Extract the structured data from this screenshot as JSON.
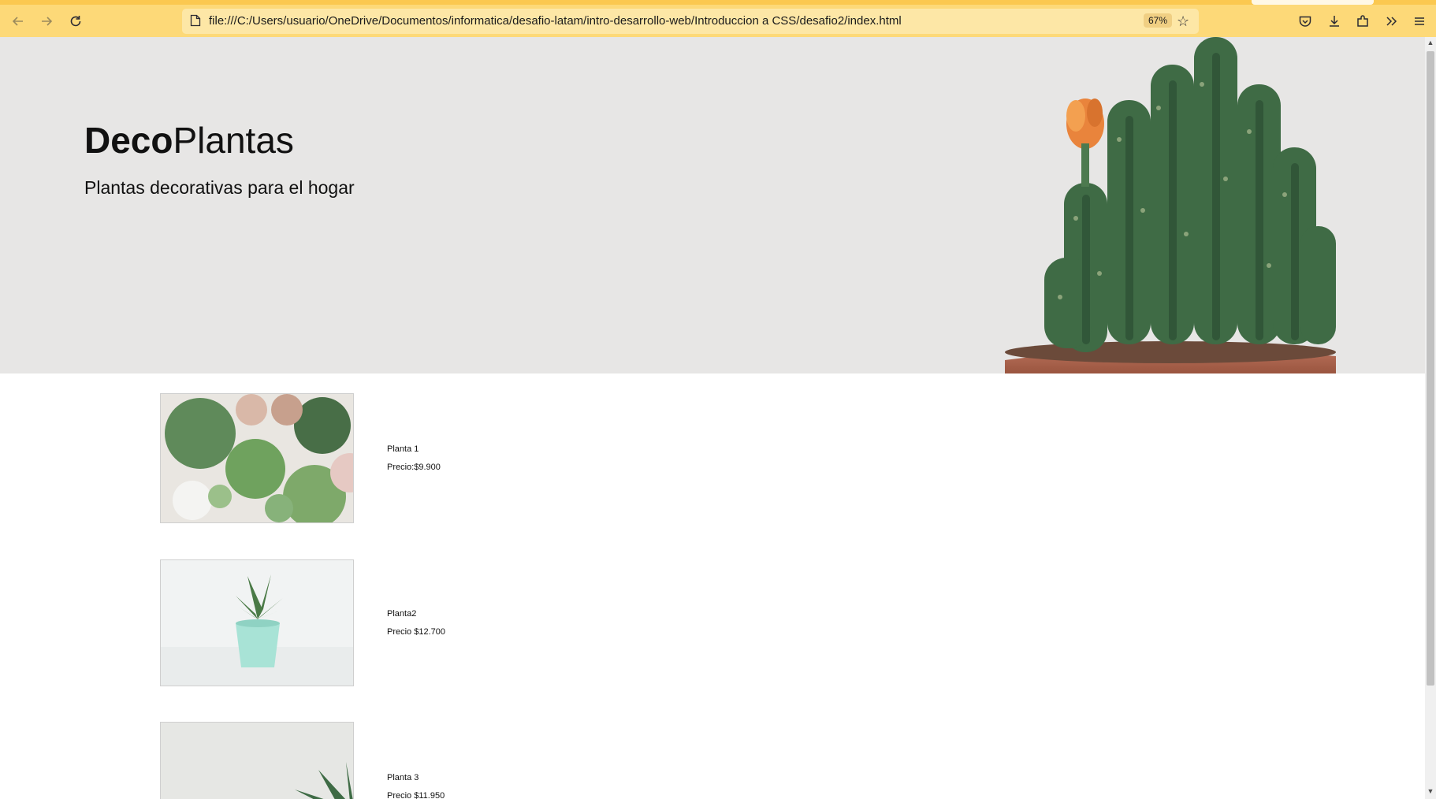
{
  "browser": {
    "url": "file:///C:/Users/usuario/OneDrive/Documentos/informatica/desafio-latam/intro-desarrollo-web/Introduccion a CSS/desafio2/index.html",
    "zoom": "67%",
    "icons": {
      "back": "arrow-left-icon",
      "forward": "arrow-right-icon",
      "reload": "reload-icon",
      "page": "page-icon",
      "bookmark": "star-icon",
      "pocket": "pocket-icon",
      "downloads": "download-icon",
      "extensions": "extensions-icon",
      "overflow": "chevron-double-right-icon",
      "menu": "hamburger-menu-icon"
    },
    "colors": {
      "toolbar": "#fdd978",
      "urlbar": "#fde7a6",
      "accent": "#fbc850"
    }
  },
  "hero": {
    "brand_bold": "Deco",
    "brand_regular": "Plantas",
    "tagline": "Plantas decorativas para el hogar",
    "background": "#e7e6e5"
  },
  "products": [
    {
      "name": "Planta 1",
      "price": "Precio:$9.900"
    },
    {
      "name": "Planta2",
      "price": "Precio $12.700"
    },
    {
      "name": "Planta 3",
      "price": "Precio $11.950"
    }
  ]
}
